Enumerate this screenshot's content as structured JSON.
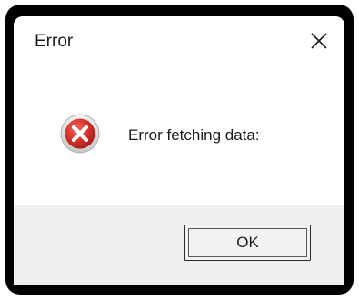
{
  "dialog": {
    "title": "Error",
    "message": "Error fetching data:",
    "ok_label": "OK",
    "icon": "error-icon",
    "close_icon": "close-icon"
  },
  "colors": {
    "frame": "#000000",
    "footer": "#f0f0f0",
    "error_red": "#d8302b",
    "text": "#1b1b1b"
  }
}
